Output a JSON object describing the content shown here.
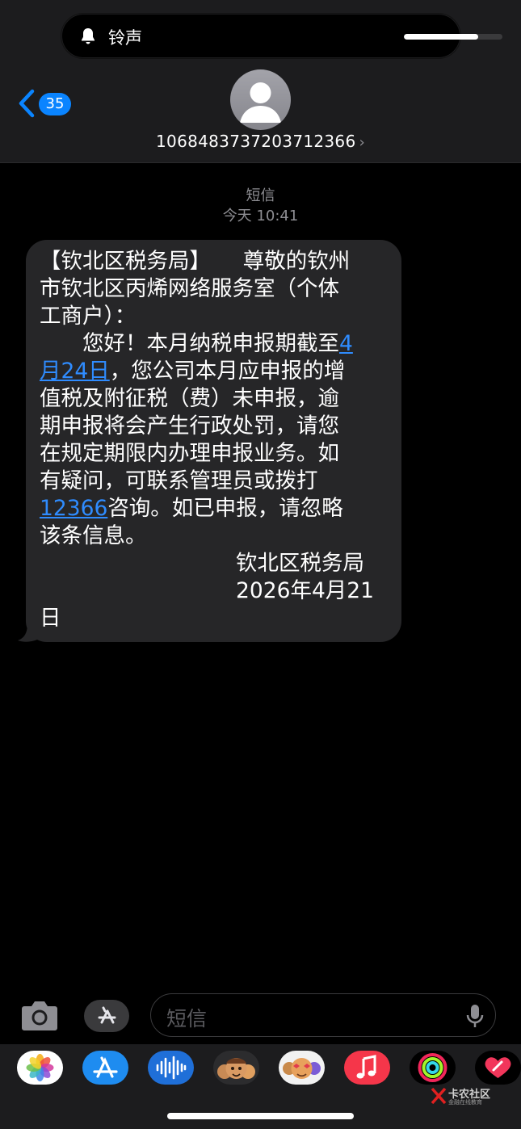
{
  "island": {
    "label": "铃声",
    "volume": 0.75
  },
  "header": {
    "unread_count": "35",
    "contact": "1068483737203712366"
  },
  "thread": {
    "service_label": "短信",
    "time_label": "今天 10:41"
  },
  "message": {
    "lines": [
      {
        "parts": [
          {
            "t": "【钦北区税务局】　　尊敬的钦州"
          }
        ]
      },
      {
        "parts": [
          {
            "t": "市钦北区丙烯网络服务室（个体"
          }
        ]
      },
      {
        "parts": [
          {
            "t": "工商户）："
          }
        ]
      },
      {
        "parts": [
          {
            "t": "　　您好！本月纳税申报期截至"
          },
          {
            "t": "4",
            "link": true
          }
        ]
      },
      {
        "parts": [
          {
            "t": "月24日",
            "link": true
          },
          {
            "t": "，您公司本月应申报的增"
          }
        ]
      },
      {
        "parts": [
          {
            "t": "值税及附征税（费）未申报，逾"
          }
        ]
      },
      {
        "parts": [
          {
            "t": "期申报将会产生行政处罚，请您"
          }
        ]
      },
      {
        "parts": [
          {
            "t": "在规定期限内办理申报业务。如"
          }
        ]
      },
      {
        "parts": [
          {
            "t": "有疑问，可联系管理员或拨打"
          }
        ]
      },
      {
        "parts": [
          {
            "t": "12366",
            "link": true
          },
          {
            "t": "咨询。如已申报，请忽略"
          }
        ]
      },
      {
        "parts": [
          {
            "t": "该条信息。"
          }
        ]
      },
      {
        "right": true,
        "parts": [
          {
            "t": "钦北区税务局"
          }
        ]
      },
      {
        "right": true,
        "parts": [
          {
            "t": "2026年4月21"
          }
        ]
      },
      {
        "parts": [
          {
            "t": "日"
          }
        ]
      }
    ]
  },
  "composer": {
    "placeholder": "短信"
  },
  "app_drawer": {
    "apps": [
      {
        "name": "photos-app-icon",
        "bg": "#ffffff"
      },
      {
        "name": "app-store-app-icon",
        "bg": "#1e8cf0"
      },
      {
        "name": "audio-message-app-icon",
        "bg": "#1f6fd8"
      },
      {
        "name": "memoji-stickers-app-icon",
        "bg": "#2c2c2e"
      },
      {
        "name": "animoji-app-icon",
        "bg": "#f2f2f2"
      },
      {
        "name": "music-app-icon",
        "bg": "#f5364a"
      },
      {
        "name": "fitness-app-icon",
        "bg": "#000000"
      },
      {
        "name": "digital-touch-app-icon",
        "bg": "#000000"
      }
    ]
  },
  "watermark": {
    "title": "卡农社区",
    "subtitle": "金融在线教育"
  },
  "colors": {
    "accent": "#0a84ff",
    "bubble": "#262628",
    "link": "#2f8cff"
  }
}
